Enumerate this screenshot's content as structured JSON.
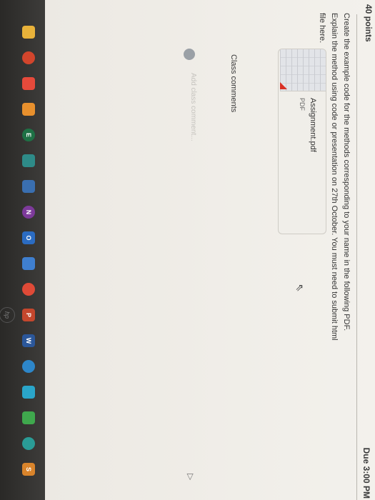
{
  "header": {
    "points": "40 points",
    "due": "Due 3:00 PM"
  },
  "instructions": "Create the example code for the methods corresponding to your name in the following PDF. Explain the method using code or presentation on 27th October. You must need to submit html file here.",
  "attachment": {
    "name": "Assignment.pdf",
    "type": "PDF"
  },
  "comments": {
    "heading": "Class comments",
    "placeholder": "Add class comment..."
  },
  "taskbar": {
    "icons": [
      {
        "name": "file-explorer-icon",
        "color": "#e8b23a",
        "label": ""
      },
      {
        "name": "app-red-icon",
        "color": "#d2452c",
        "label": ""
      },
      {
        "name": "chrome-icon",
        "color": "#e64a3b",
        "label": ""
      },
      {
        "name": "firefox-icon",
        "color": "#e8902d",
        "label": ""
      },
      {
        "name": "excel-icon",
        "color": "#1e7145",
        "label": "E"
      },
      {
        "name": "app-teal-icon",
        "color": "#2e8b88",
        "label": ""
      },
      {
        "name": "store-icon",
        "color": "#3a6fb0",
        "label": ""
      },
      {
        "name": "onenote-icon",
        "color": "#7d3a9a",
        "label": "N"
      },
      {
        "name": "outlook-icon",
        "color": "#2b6cc2",
        "label": "O"
      },
      {
        "name": "app-blue-icon",
        "color": "#3f7fcf",
        "label": ""
      },
      {
        "name": "chrome-2-icon",
        "color": "#df4a37",
        "label": ""
      },
      {
        "name": "powerpoint-icon",
        "color": "#c5472d",
        "label": "P"
      },
      {
        "name": "word-icon",
        "color": "#2b579a",
        "label": "W"
      },
      {
        "name": "edge-icon",
        "color": "#2d86c9",
        "label": ""
      },
      {
        "name": "app-cyan-icon",
        "color": "#2aa5c9",
        "label": ""
      },
      {
        "name": "app-green-icon",
        "color": "#3fa84d",
        "label": ""
      },
      {
        "name": "app-teal2-icon",
        "color": "#2a9c96",
        "label": ""
      },
      {
        "name": "app-orange-icon",
        "color": "#d9842b",
        "label": "S"
      }
    ]
  }
}
